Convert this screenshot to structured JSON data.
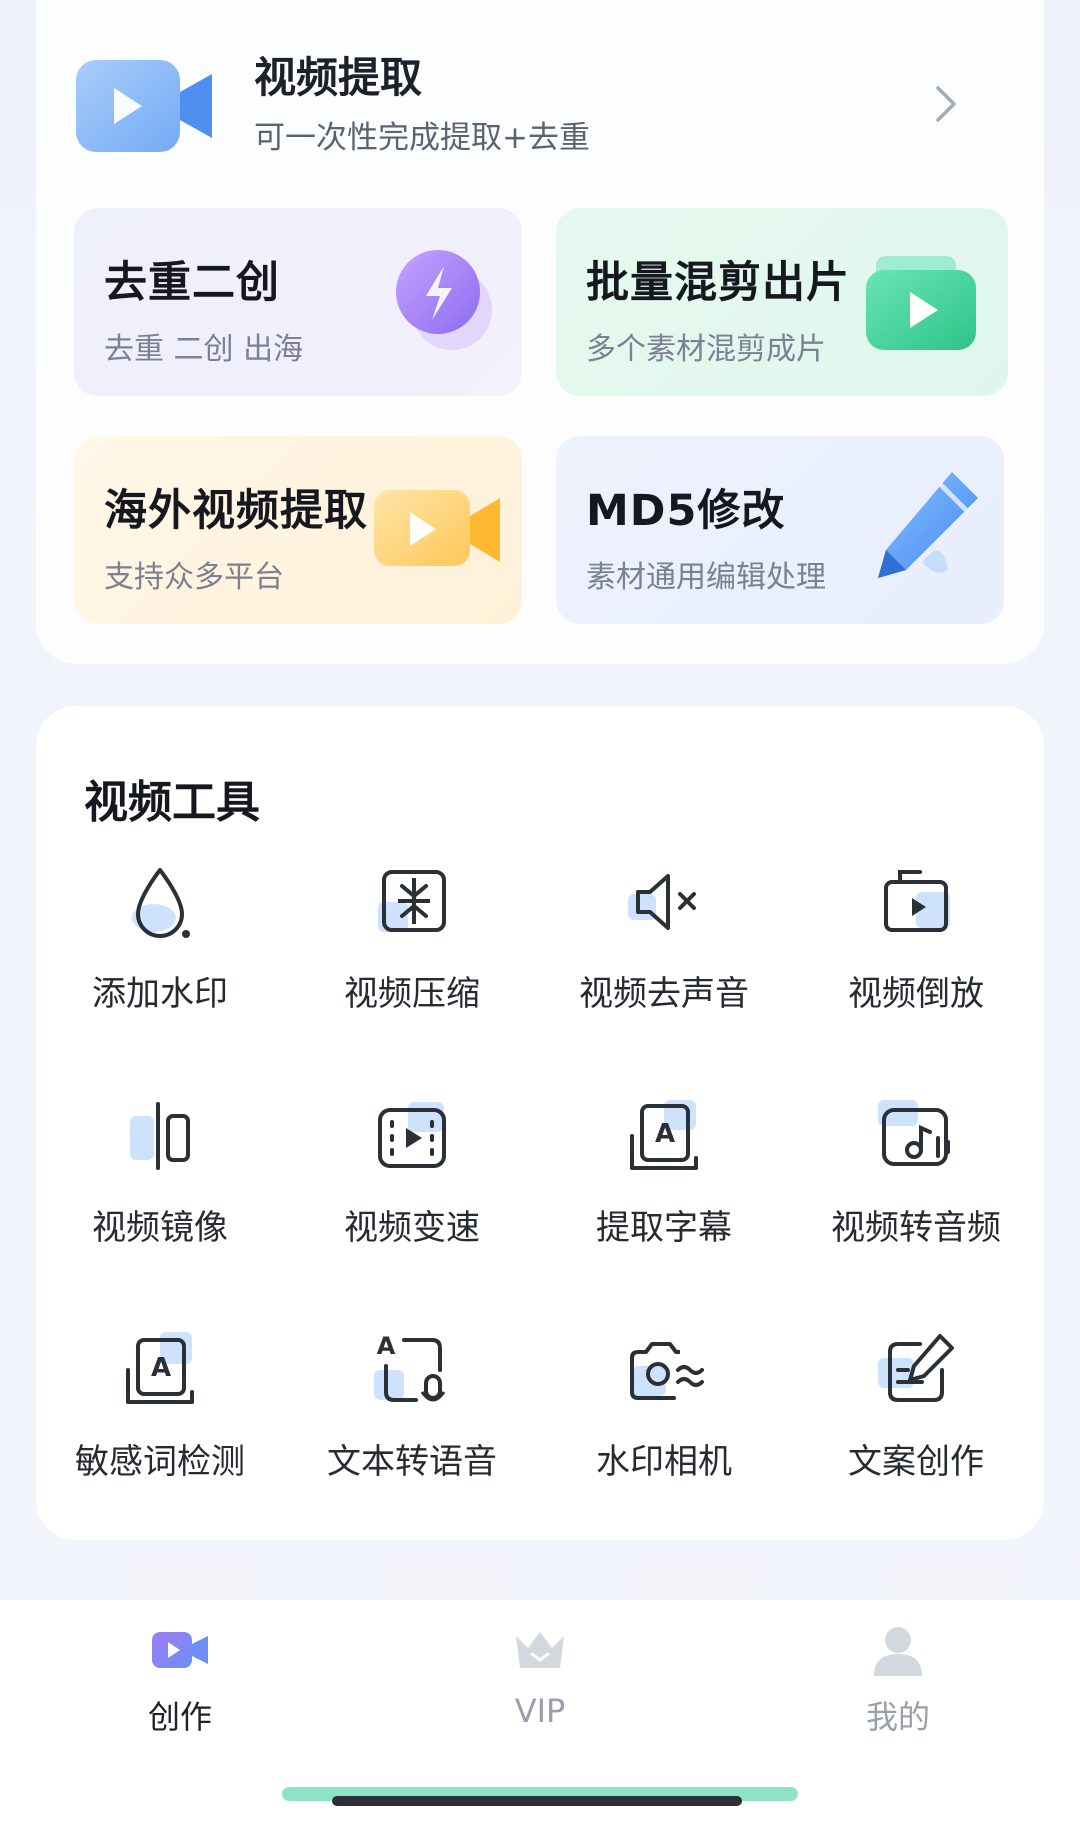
{
  "extract": {
    "title": "视频提取",
    "subtitle": "可一次性完成提取+去重",
    "icon": "video-camera-icon"
  },
  "features": [
    {
      "title": "去重二创",
      "subtitle": "去重 二创 出海",
      "icon": "lightning-icon",
      "color": "#9b7bf0"
    },
    {
      "title": "批量混剪出片",
      "subtitle": "多个素材混剪成片",
      "icon": "play-folder-icon",
      "color": "#3fd39b"
    },
    {
      "title": "海外视频提取",
      "subtitle": "支持众多平台",
      "icon": "video-camera-icon",
      "color": "#ffc24a"
    },
    {
      "title": "MD5修改",
      "subtitle": "素材通用编辑处理",
      "icon": "pencil-icon",
      "color": "#5b9cf5"
    }
  ],
  "tools": {
    "title": "视频工具",
    "items": [
      {
        "label": "添加水印",
        "icon": "water-drop-icon"
      },
      {
        "label": "视频压缩",
        "icon": "compress-icon"
      },
      {
        "label": "视频去声音",
        "icon": "mute-speaker-icon"
      },
      {
        "label": "视频倒放",
        "icon": "reverse-play-icon"
      },
      {
        "label": "视频镜像",
        "icon": "mirror-icon"
      },
      {
        "label": "视频变速",
        "icon": "film-speed-icon"
      },
      {
        "label": "提取字幕",
        "icon": "subtitle-icon"
      },
      {
        "label": "视频转音频",
        "icon": "video-to-audio-icon"
      },
      {
        "label": "敏感词检测",
        "icon": "sensitive-word-icon"
      },
      {
        "label": "文本转语音",
        "icon": "text-to-speech-icon"
      },
      {
        "label": "水印相机",
        "icon": "watermark-camera-icon"
      },
      {
        "label": "文案创作",
        "icon": "copywriting-icon"
      }
    ]
  },
  "tabbar": {
    "create": "创作",
    "vip": "VIP",
    "mine": "我的"
  },
  "colors": {
    "accent_blue": "#5b9cf5",
    "accent_green": "#3fd39b",
    "accent_purple": "#9b7bf0",
    "accent_orange": "#ffc24a",
    "text_primary": "#1d2129",
    "text_secondary": "#7b8190"
  }
}
